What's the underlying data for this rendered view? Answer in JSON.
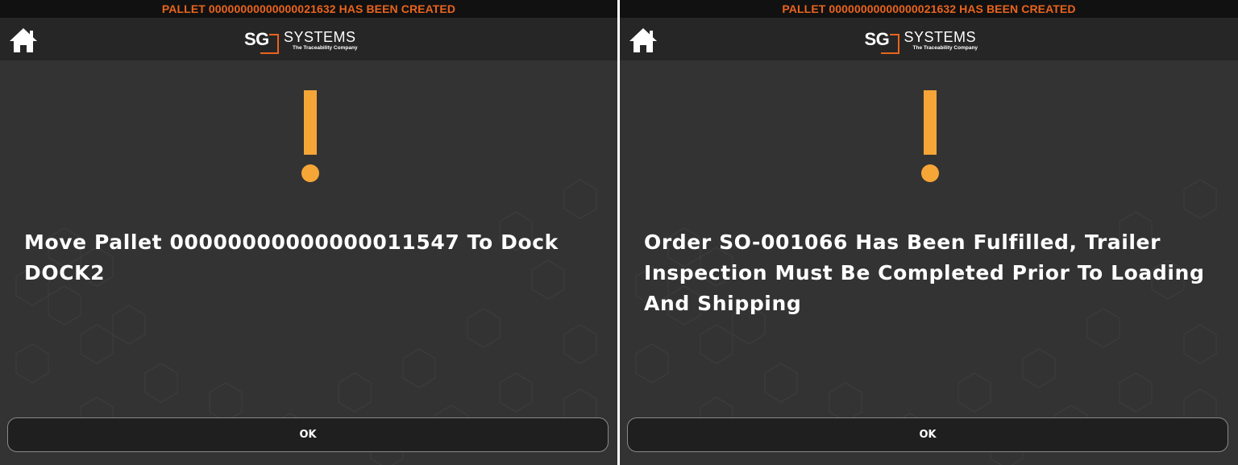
{
  "screens": [
    {
      "banner": "PALLET 00000000000000021632 HAS BEEN CREATED",
      "home_icon": "home-icon",
      "logo": {
        "sg": "SG",
        "systems": "SYSTEMS",
        "tagline": "The Traceability Company"
      },
      "alert_icon": "exclamation-icon",
      "message": "Move Pallet 00000000000000011547 To Dock DOCK2",
      "ok_label": "OK"
    },
    {
      "banner": "PALLET 00000000000000021632 HAS BEEN CREATED",
      "home_icon": "home-icon",
      "logo": {
        "sg": "SG",
        "systems": "SYSTEMS",
        "tagline": "The Traceability Company"
      },
      "alert_icon": "exclamation-icon",
      "message": "Order SO-001066 Has Been Fulfilled, Trailer Inspection Must Be Completed Prior To Loading And Shipping",
      "ok_label": "OK"
    }
  ],
  "colors": {
    "banner_text": "#e8641e",
    "alert": "#f6a637",
    "panel_bg": "#333333",
    "header_bg": "#262626"
  }
}
